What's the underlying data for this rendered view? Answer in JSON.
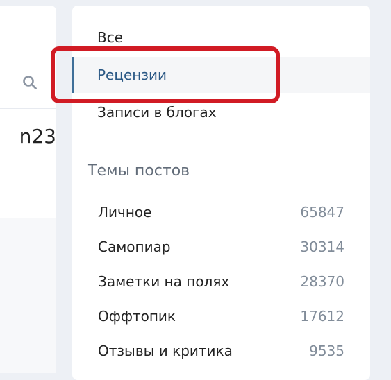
{
  "left_panel": {
    "partial_text": "n23"
  },
  "menu": {
    "items": [
      {
        "label": "Все"
      },
      {
        "label": "Рецензии"
      },
      {
        "label": "Записи в блогах"
      }
    ]
  },
  "topics": {
    "title": "Темы постов",
    "items": [
      {
        "label": "Личное",
        "count": "65847"
      },
      {
        "label": "Самопиар",
        "count": "30314"
      },
      {
        "label": "Заметки на полях",
        "count": "28370"
      },
      {
        "label": "Оффтопик",
        "count": "17612"
      },
      {
        "label": "Отзывы и критика",
        "count": "9535"
      }
    ]
  },
  "colors": {
    "highlight": "#d11b24",
    "active_text": "#2a5885",
    "active_bar": "#3f6f99"
  }
}
